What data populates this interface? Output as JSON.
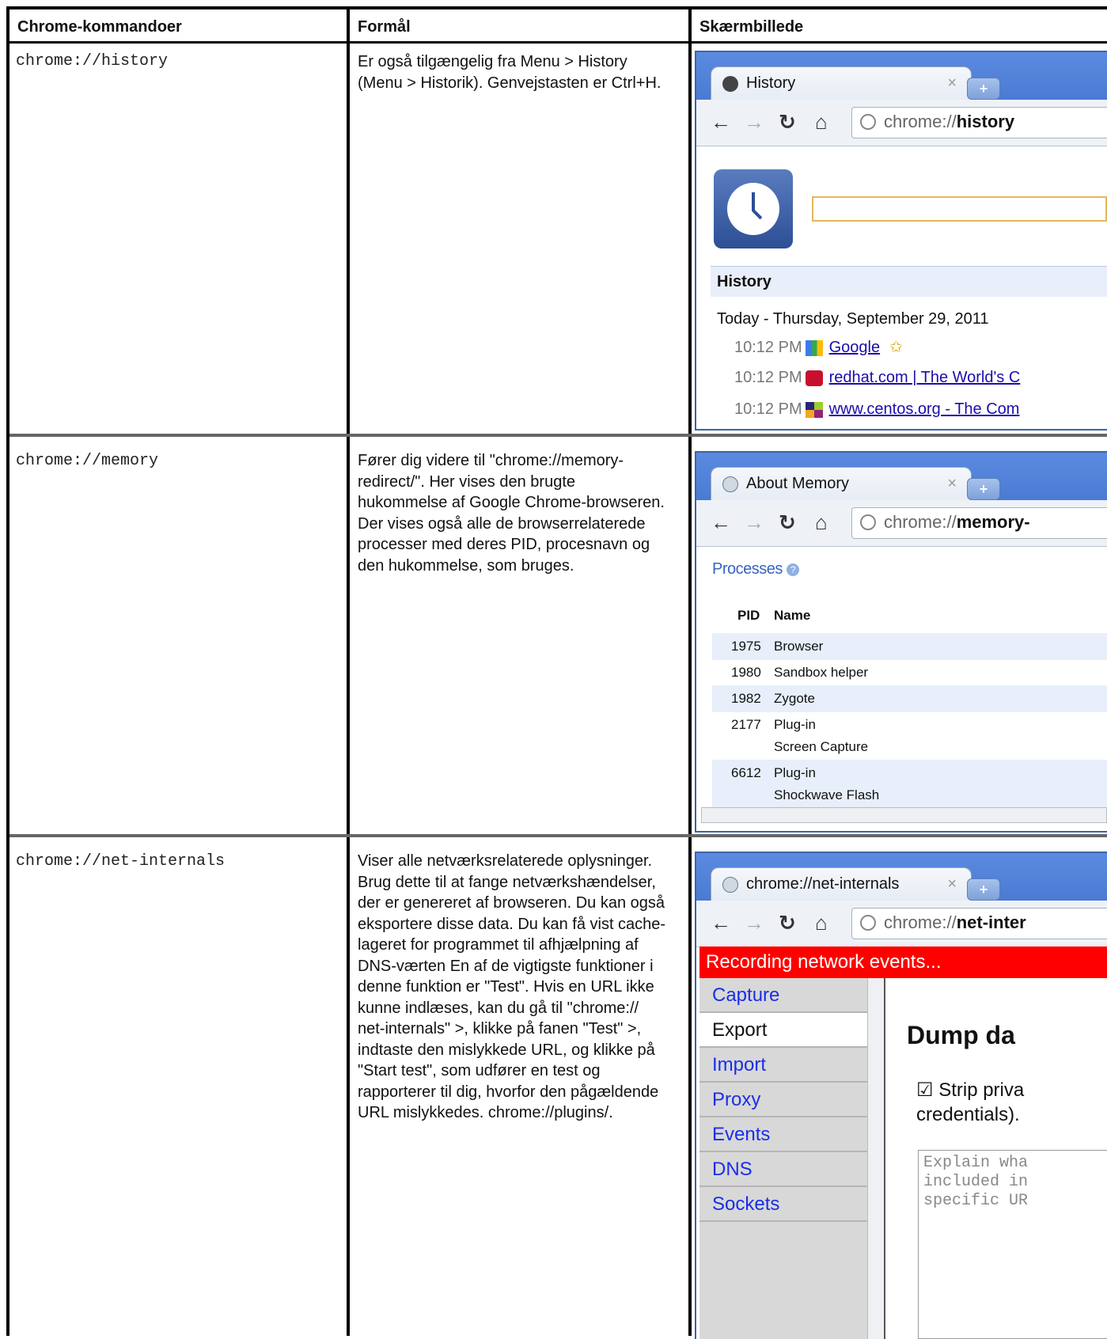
{
  "headers": {
    "commands": "Chrome-kommandoer",
    "purpose": "Formål",
    "screenshot": "Skærmbillede"
  },
  "rows": [
    {
      "command": "chrome://history",
      "purpose": [
        "Er også tilgængelig fra Menu > History",
        "(Menu > Historik). Genvejstasten er Ctrl+H."
      ]
    },
    {
      "command": "chrome://memory",
      "purpose": [
        "Fører dig videre til \"chrome://memory-",
        "redirect/\". Her vises den brugte",
        "hukommelse af Google Chrome-browseren.",
        "Der vises også alle de browserrelaterede",
        "processer med deres PID, procesnavn og",
        "den hukommelse, som bruges."
      ]
    },
    {
      "command": "chrome://net-internals",
      "purpose": [
        "Viser alle netværksrelaterede oplysninger.",
        "Brug dette til at fange netværkshændelser,",
        "der er genereret af browseren. Du kan også",
        "eksportere disse data. Du kan få vist cache-",
        "lageret for programmet til afhjælpning af",
        "DNS-værten En af de vigtigste funktioner i",
        "denne funktion er \"Test\". Hvis en URL ikke",
        "kunne indlæses, kan du gå til \"chrome://",
        "net-internals\" >, klikke på fanen \"Test\" >,",
        "indtaste den mislykkede URL, og klikke på",
        "\"Start test\", som udfører en test og",
        "rapporterer til dig, hvorfor den pågældende",
        "URL mislykkedes. chrome://plugins/."
      ]
    }
  ],
  "shots": {
    "history": {
      "tab_title": "History",
      "tab_close": "×",
      "new_tab": "+",
      "url_prefix": "chrome://",
      "url_host": "history",
      "section_title": "History",
      "day": "Today - Thursday, September 29, 2011",
      "entries": [
        {
          "time": "10:12 PM",
          "title": "Google",
          "starred": "✩"
        },
        {
          "time": "10:12 PM",
          "title": "redhat.com | The World's C"
        },
        {
          "time": "10:12 PM",
          "title": "www.centos.org - The Com"
        }
      ]
    },
    "memory": {
      "tab_title": "About Memory",
      "tab_close": "×",
      "new_tab": "+",
      "url_prefix": "chrome://",
      "url_host": "memory-",
      "processes_label": "Processes",
      "help_icon": "?",
      "col_pid": "PID",
      "col_name": "Name",
      "processes": [
        {
          "pid": "1975",
          "name": "Browser",
          "sub": ""
        },
        {
          "pid": "1980",
          "name": "Sandbox helper",
          "sub": ""
        },
        {
          "pid": "1982",
          "name": "Zygote",
          "sub": ""
        },
        {
          "pid": "2177",
          "name": "Plug-in",
          "sub": "Screen Capture"
        },
        {
          "pid": "6612",
          "name": "Plug-in",
          "sub": "Shockwave Flash"
        }
      ]
    },
    "net": {
      "tab_title": "chrome://net-internals",
      "tab_close": "×",
      "new_tab": "+",
      "url_prefix": "chrome://",
      "url_host": "net-inter",
      "recording": "Recording network events...",
      "nav_items": [
        "Capture",
        "Export",
        "Import",
        "Proxy",
        "Events",
        "DNS",
        "Sockets"
      ],
      "active_item": "Export",
      "heading": "Dump da",
      "checkbox_line1": "Strip priva",
      "checkbox_line2": "credentials).",
      "textarea_lines": [
        "Explain wha",
        "included in",
        "specific UR"
      ]
    }
  }
}
